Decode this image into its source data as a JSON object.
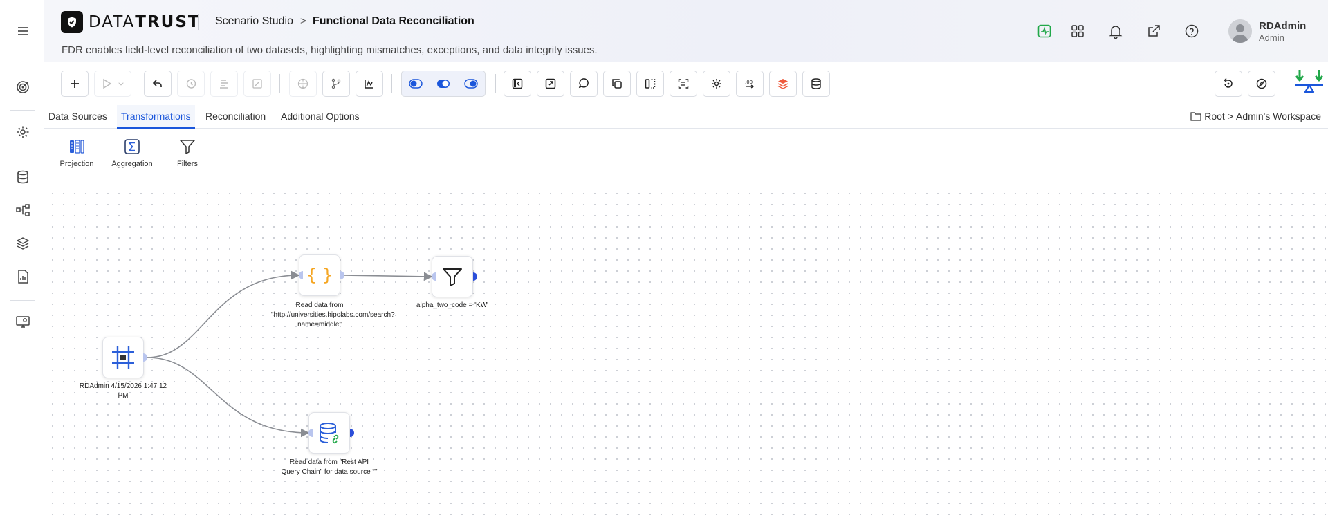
{
  "app": {
    "brand_light": "DATA",
    "brand_bold": "TRUST",
    "breadcrumb_parent": "Scenario Studio",
    "breadcrumb_sep": ">",
    "breadcrumb_current": "Functional Data Reconciliation",
    "subtitle": "FDR enables field-level reconciliation of two datasets, highlighting mismatches, exceptions, and data integrity issues."
  },
  "user": {
    "name": "RDAdmin",
    "role": "Admin"
  },
  "header_icons": [
    "activity-icon",
    "apps-grid-icon",
    "bell-icon",
    "external-link-icon",
    "help-icon"
  ],
  "rail_icons": [
    "target-icon",
    "settings-icon",
    "database-icon",
    "workflow-icon",
    "layers-icon",
    "report-icon",
    "monitor-icon"
  ],
  "tabs": [
    {
      "label": "Data Sources",
      "active": false
    },
    {
      "label": "Transformations",
      "active": true
    },
    {
      "label": "Reconciliation",
      "active": false
    },
    {
      "label": "Additional Options",
      "active": false
    }
  ],
  "location": {
    "root": "Root",
    "sep": ">",
    "workspace": "Admin's Workspace"
  },
  "transform_tools": [
    {
      "label": "Projection",
      "icon": "projection-icon"
    },
    {
      "label": "Aggregation",
      "icon": "aggregation-icon"
    },
    {
      "label": "Filters",
      "icon": "filter-icon"
    }
  ],
  "nodes": {
    "source": {
      "label": "RDAdmin 4/15/2026 1:47:12 PM",
      "icon": "frame-icon"
    },
    "json": {
      "label": "Read data from \"http://universities.hipolabs.com/search?name=middle\"",
      "icon": "json-braces-icon"
    },
    "filter": {
      "label": "alpha_two_code = 'KW'",
      "icon": "filter-icon"
    },
    "db": {
      "label": "Read data from \"Rest API Query Chain\" for data source \"\"",
      "icon": "database-link-icon"
    }
  },
  "colors": {
    "accent": "#1a56db",
    "brand_dark": "#111111",
    "json_orange": "#f5a623",
    "green": "#22a84a"
  }
}
